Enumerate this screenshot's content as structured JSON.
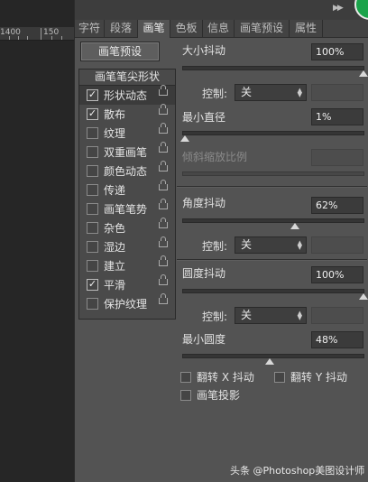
{
  "ruler": {
    "label_a": "1400",
    "label_b": "150"
  },
  "tabs": [
    "字符",
    "段落",
    "画笔",
    "色板",
    "信息",
    "画笔预设",
    "属性"
  ],
  "active_tab": "画笔",
  "preset_button": "画笔预设",
  "list_header": "画笔笔尖形状",
  "options": [
    {
      "label": "形状动态",
      "checked": true,
      "selected": true
    },
    {
      "label": "散布",
      "checked": true
    },
    {
      "label": "纹理",
      "checked": false
    },
    {
      "label": "双重画笔",
      "checked": false
    },
    {
      "label": "颜色动态",
      "checked": false
    },
    {
      "label": "传递",
      "checked": false
    },
    {
      "label": "画笔笔势",
      "checked": false
    },
    {
      "label": "杂色",
      "checked": false
    },
    {
      "label": "湿边",
      "checked": false
    },
    {
      "label": "建立",
      "checked": false
    },
    {
      "label": "平滑",
      "checked": true
    },
    {
      "label": "保护纹理",
      "checked": false
    }
  ],
  "size_jitter": {
    "label": "大小抖动",
    "value": "100%",
    "level": 1.0
  },
  "control_1": {
    "label": "控制:",
    "value": "关"
  },
  "min_diameter": {
    "label": "最小直径",
    "value": "1%",
    "level": 0.01
  },
  "tilt_scale": {
    "label": "倾斜缩放比例"
  },
  "angle_jitter": {
    "label": "角度抖动",
    "value": "62%",
    "level": 0.62
  },
  "control_2": {
    "label": "控制:",
    "value": "关"
  },
  "roundness_jitter": {
    "label": "圆度抖动",
    "value": "100%",
    "level": 1.0
  },
  "control_3": {
    "label": "控制:",
    "value": "关"
  },
  "min_roundness": {
    "label": "最小圆度",
    "value": "48%",
    "level": 0.48
  },
  "flip_x": "翻转 X 抖动",
  "flip_y": "翻转 Y 抖动",
  "brush_projection": "画笔投影",
  "watermark": "头条 @Photoshop美图设计师"
}
